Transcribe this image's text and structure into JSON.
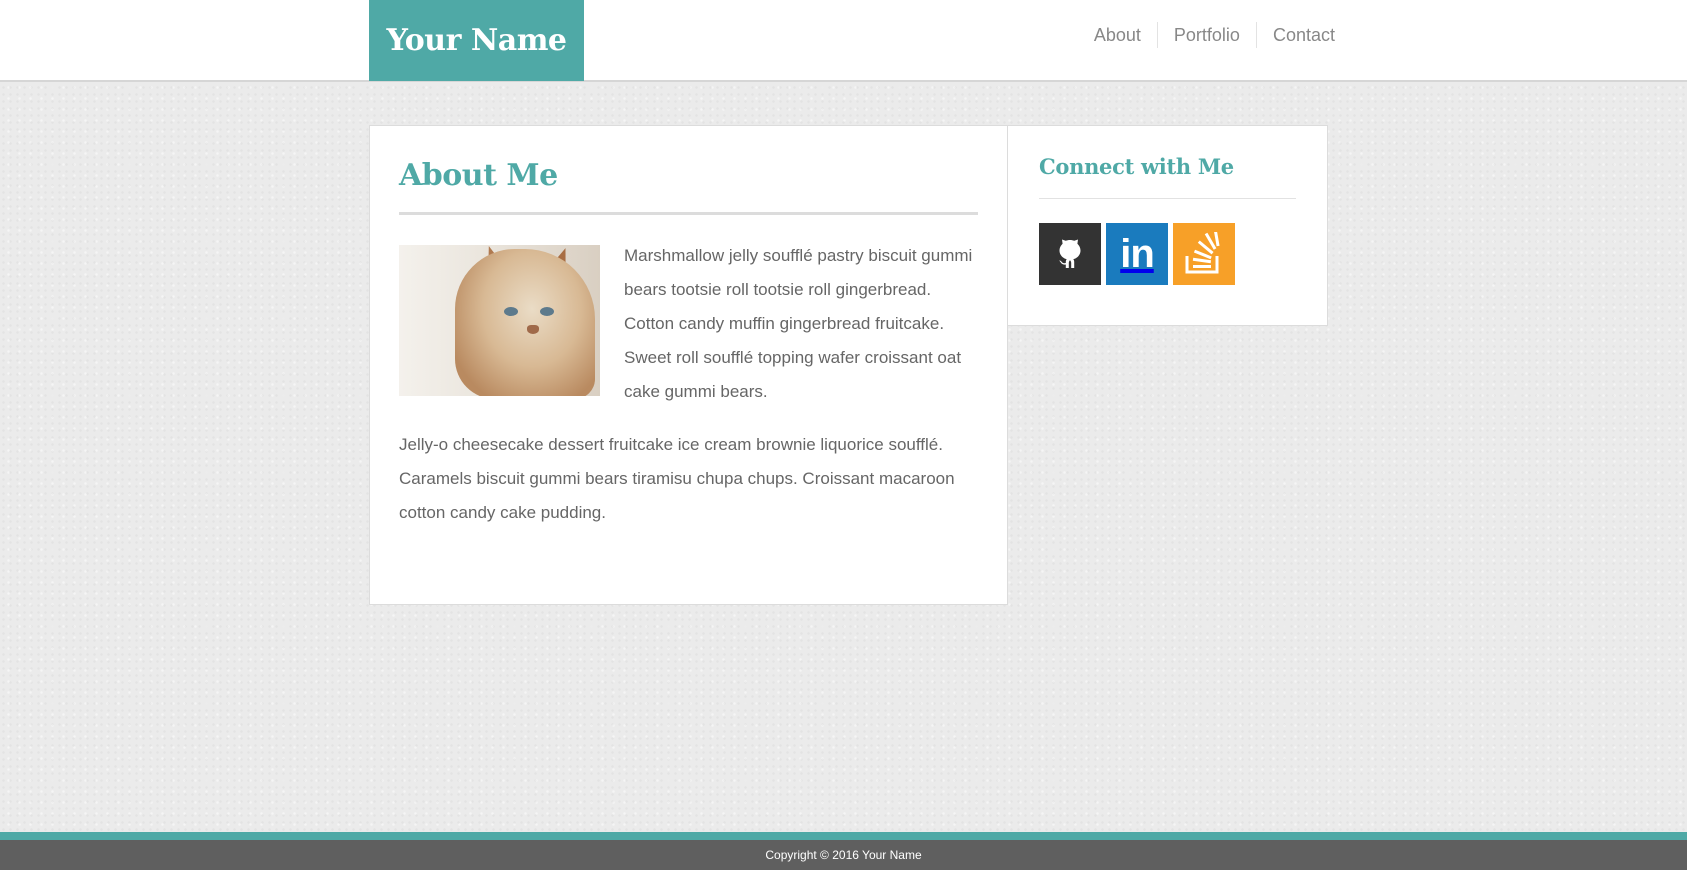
{
  "header": {
    "logo_text": "Your Name",
    "nav": [
      {
        "label": "About"
      },
      {
        "label": "Portfolio"
      },
      {
        "label": "Contact"
      }
    ]
  },
  "main": {
    "title": "About Me",
    "image": {
      "icon": "cat-photo"
    },
    "paragraphs": [
      "Marshmallow jelly soufflé pastry biscuit gummi bears tootsie roll tootsie roll gingerbread. Cotton candy muffin gingerbread fruitcake. Sweet roll soufflé topping wafer croissant oat cake gummi bears.",
      "Jelly-o cheesecake dessert fruitcake ice cream brownie liquorice soufflé. Caramels biscuit gummi bears tiramisu chupa chups. Croissant macaroon cotton candy cake pudding."
    ]
  },
  "sidebar": {
    "title": "Connect with Me",
    "social": [
      {
        "icon": "github-icon",
        "color": "#333333"
      },
      {
        "icon": "linkedin-icon",
        "color": "#1a7bbe",
        "glyph": "in"
      },
      {
        "icon": "stackoverflow-icon",
        "color": "#f7a028"
      }
    ]
  },
  "footer": {
    "copyright": "Copyright © 2016 Your Name"
  },
  "colors": {
    "accent": "#4fa9a6",
    "footer": "#5f5f5f",
    "text": "#666666",
    "nav_text": "#888888"
  }
}
